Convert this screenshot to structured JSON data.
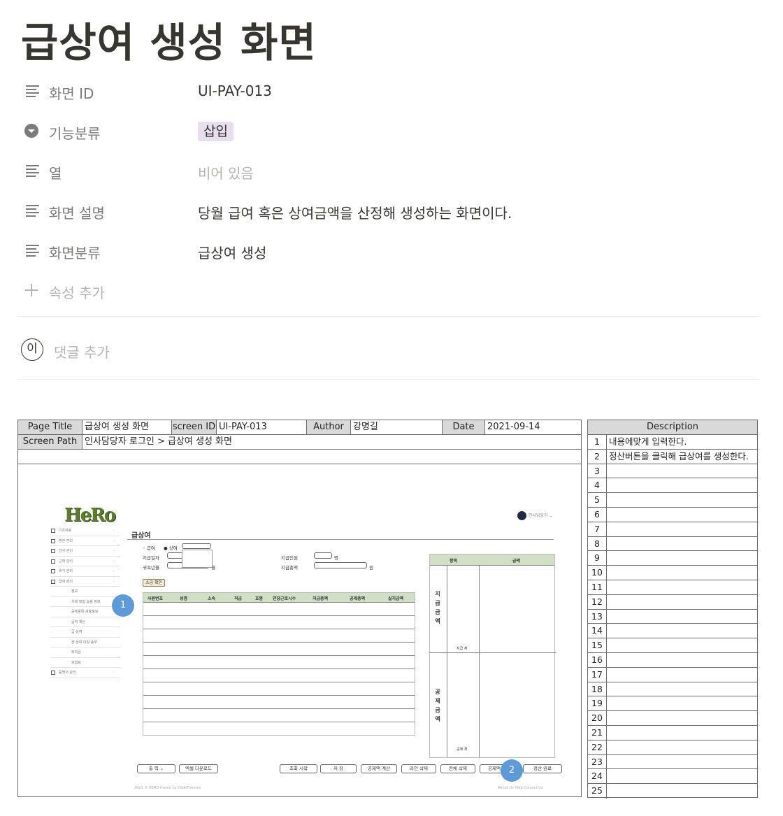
{
  "page": {
    "title": "급상여 생성 화면"
  },
  "properties": [
    {
      "icon": "text-lines-icon",
      "name": "화면 ID",
      "value": "UI-PAY-013"
    },
    {
      "icon": "select-icon",
      "name": "기능분류",
      "value": "삽입"
    },
    {
      "icon": "text-lines-icon",
      "name": "열",
      "value": "비어 있음"
    },
    {
      "icon": "text-lines-icon",
      "name": "화면 설명",
      "value": "당월 급여 혹은 상여금액을 산정해 생성하는 화면이다."
    },
    {
      "icon": "text-lines-icon",
      "name": "화면분류",
      "value": "급상여 생성"
    }
  ],
  "add_property": "속성 추가",
  "comment": {
    "avatar": "이",
    "placeholder": "댓글 추가"
  },
  "spec": {
    "page_title_label": "Page Title",
    "page_title": "급상여 생성 화면",
    "screen_id_label": "screen ID",
    "screen_id": "UI-PAY-013",
    "author_label": "Author",
    "author": "강명길",
    "date_label": "Date",
    "date": "2021-09-14",
    "screen_path_label": "Screen Path",
    "screen_path": "인사담당자 로그인 > 급상여 생성 화면"
  },
  "description": {
    "header": "Description",
    "rows": [
      {
        "n": "1",
        "t": "내용에맞게 입력한다."
      },
      {
        "n": "2",
        "t": "정산버튼을 클릭해 급상여를 생성한다."
      },
      {
        "n": "3",
        "t": ""
      },
      {
        "n": "4",
        "t": ""
      },
      {
        "n": "5",
        "t": ""
      },
      {
        "n": "6",
        "t": ""
      },
      {
        "n": "7",
        "t": ""
      },
      {
        "n": "8",
        "t": ""
      },
      {
        "n": "9",
        "t": ""
      },
      {
        "n": "10",
        "t": ""
      },
      {
        "n": "11",
        "t": ""
      },
      {
        "n": "12",
        "t": ""
      },
      {
        "n": "13",
        "t": ""
      },
      {
        "n": "14",
        "t": ""
      },
      {
        "n": "15",
        "t": ""
      },
      {
        "n": "16",
        "t": ""
      },
      {
        "n": "17",
        "t": ""
      },
      {
        "n": "18",
        "t": ""
      },
      {
        "n": "19",
        "t": ""
      },
      {
        "n": "20",
        "t": ""
      },
      {
        "n": "21",
        "t": ""
      },
      {
        "n": "22",
        "t": ""
      },
      {
        "n": "23",
        "t": ""
      },
      {
        "n": "24",
        "t": ""
      },
      {
        "n": "25",
        "t": ""
      }
    ]
  },
  "app": {
    "logo": "HeRo",
    "user": "인사담당자 ⌄",
    "page_title": "급상여",
    "radio_pay": "◦ 급여",
    "radio_bonus": "● 상여",
    "pay_date_label": "지급일자",
    "attribution_label": "귀속년월",
    "month_suffix": "월",
    "headcount_label": "지급인원",
    "headcount_suffix": "명",
    "total_label": "지급총액",
    "total_suffix": "원",
    "confirm_btn": "소급 확인",
    "grid_headers": [
      "사원번호",
      "성명",
      "소속",
      "직급",
      "호봉",
      "연장근로시수",
      "지급총액",
      "공제총액",
      "실지급액"
    ],
    "right_headers": [
      "항목",
      "금액"
    ],
    "pay_section": "지급금액",
    "pay_sum": "지급 계",
    "deduct_section": "공제금액",
    "deduct_sum": "공제 계",
    "sidebar": [
      "기초자료",
      "권한 관리",
      "인사 관리",
      "근태 관리",
      "휴가 관리",
      "급여 관리",
      "정보",
      "사대 보험 요율 정보",
      "공제항목·세율정보",
      "급여 계산",
      "급·상여",
      "급·상여 대장·송부",
      "퇴직금",
      "보험료",
      "증명서 관리"
    ],
    "buttons": [
      "출 력 ⌄",
      "엑셀 다운로드",
      "조회 시작",
      "저 장",
      "공제액 계산",
      "라인 삭제",
      "전체 삭제",
      "공제액 업",
      "정산 완료"
    ],
    "footer_left": "2021 © HERO theme by CodeThemes",
    "footer_right": "About Us    Help    Contact Us"
  },
  "markers": [
    "1",
    "2"
  ]
}
